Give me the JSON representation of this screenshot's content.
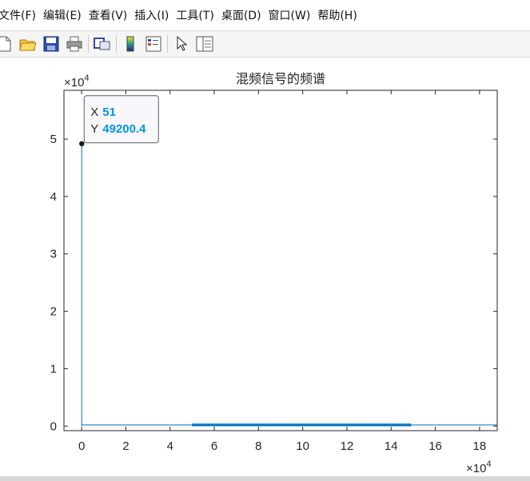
{
  "menu": {
    "items": [
      "文件(F)",
      "编辑(E)",
      "查看(V)",
      "插入(I)",
      "工具(T)",
      "桌面(D)",
      "窗口(W)",
      "帮助(H)"
    ]
  },
  "toolbar": {
    "buttons": [
      {
        "name": "new-figure-icon"
      },
      {
        "name": "open-file-icon"
      },
      {
        "name": "save-icon"
      },
      {
        "name": "print-icon"
      },
      {
        "name": "link-plot-icon"
      },
      {
        "name": "insert-colorbar-icon"
      },
      {
        "name": "insert-legend-icon"
      },
      {
        "name": "edit-plot-arrow-icon"
      },
      {
        "name": "property-inspector-icon"
      }
    ]
  },
  "chart_data": {
    "type": "line",
    "title": "混频信号的频谱",
    "xlabel": "",
    "ylabel": "",
    "x_exponent": "×10",
    "x_exponent_power": "4",
    "y_exponent": "×10",
    "y_exponent_power": "4",
    "xlim": [
      -0.8,
      18.8
    ],
    "ylim": [
      -0.08,
      5.85
    ],
    "xticks": [
      0,
      2,
      4,
      6,
      8,
      10,
      12,
      14,
      16,
      18
    ],
    "yticks": [
      0,
      1,
      2,
      3,
      4,
      5
    ],
    "series": [
      {
        "color": "#0072bd",
        "spike": {
          "x": 0.0051,
          "y": 4.92004
        },
        "baseline": {
          "x0": 0,
          "x1": 18.8,
          "y": 0.02
        },
        "noise_band": {
          "x0": 5.0,
          "x1": 14.9,
          "y": 0.02
        }
      }
    ],
    "datatip": {
      "x_label": "X",
      "x_value": "51",
      "y_label": "Y",
      "y_value": "49200.4",
      "point": {
        "x": 0.0051,
        "y": 4.92004
      }
    },
    "grid": false
  },
  "colors": {
    "series": "#0072bd",
    "datatip_value": "#0096e6",
    "axis": "#262626"
  }
}
